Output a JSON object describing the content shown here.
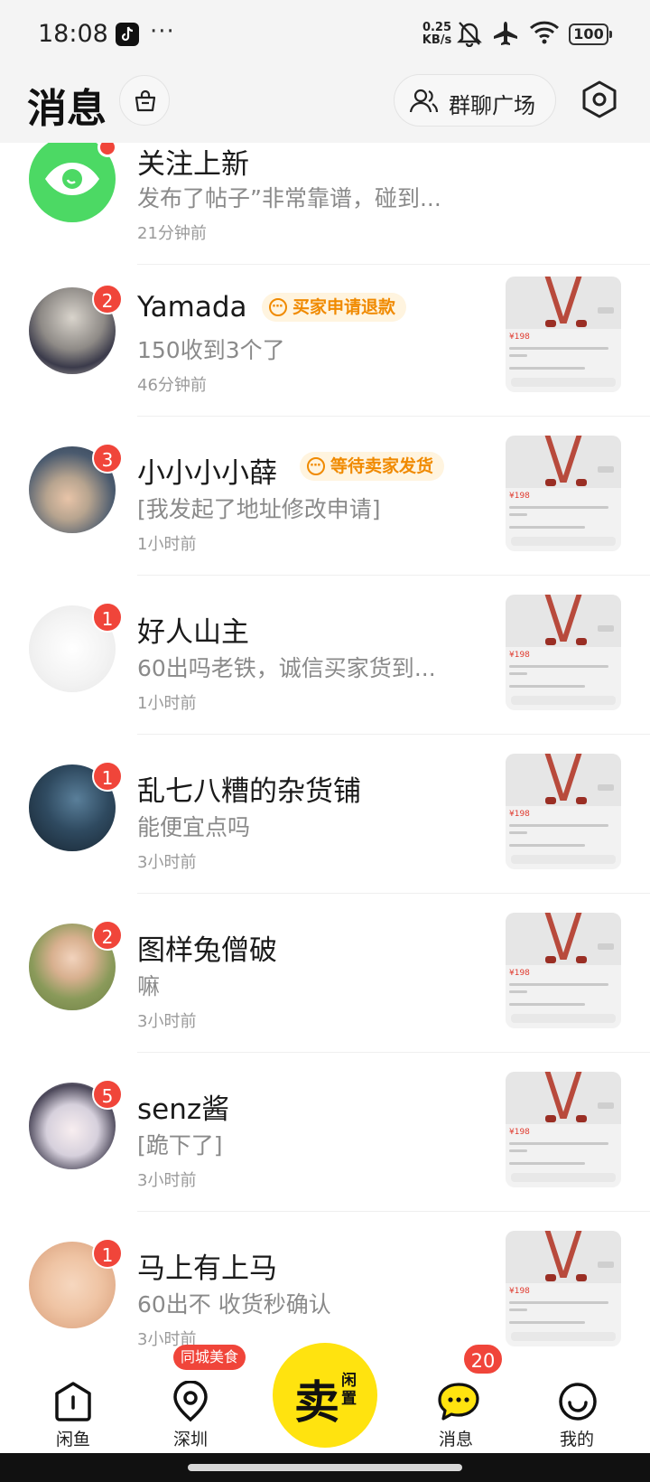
{
  "status_bar": {
    "time": "18:08",
    "more": "···",
    "net_speed_value": "0.25",
    "net_speed_unit": "KB/s",
    "battery": "100"
  },
  "header": {
    "title": "消息",
    "group_chat_label": "群聊广场"
  },
  "colors": {
    "badge_red": "#f0453a",
    "tag_orange": "#f08a00",
    "sell_yellow": "#ffe30f",
    "follow_green": "#4cd964"
  },
  "messages": [
    {
      "name": "关注上新",
      "preview": "发布了帖子”非常靠谱，碰到...",
      "time": "21分钟前",
      "badge": "",
      "tag": "",
      "icon": "eye-icon"
    },
    {
      "name": "Yamada",
      "preview": "150收到3个了",
      "time": "46分钟前",
      "badge": "2",
      "tag": "买家申请退款"
    },
    {
      "name": "小小小小薛",
      "preview": "[我发起了地址修改申请]",
      "time": "1小时前",
      "badge": "3",
      "tag": "等待卖家发货"
    },
    {
      "name": "好人山主",
      "preview": "60出吗老铁，诚信买家货到...",
      "time": "1小时前",
      "badge": "1",
      "tag": ""
    },
    {
      "name": "乱七八糟的杂货铺",
      "preview": "能便宜点吗",
      "time": "3小时前",
      "badge": "1",
      "tag": ""
    },
    {
      "name": "图样兔僧破",
      "preview": "嘛",
      "time": "3小时前",
      "badge": "2",
      "tag": ""
    },
    {
      "name": "senz酱",
      "preview": "[跪下了]",
      "time": "3小时前",
      "badge": "5",
      "tag": ""
    },
    {
      "name": "马上有上马",
      "preview": "60出不 收货秒确认",
      "time": "3小时前",
      "badge": "1",
      "tag": ""
    }
  ],
  "thumb_price": "¥198",
  "tab_bar": {
    "home": "闲鱼",
    "city": "深圳",
    "city_tag": "同城美食",
    "sell_main": "卖",
    "sell_sub": "闲置",
    "messages": "消息",
    "messages_count": "20",
    "me": "我的"
  }
}
